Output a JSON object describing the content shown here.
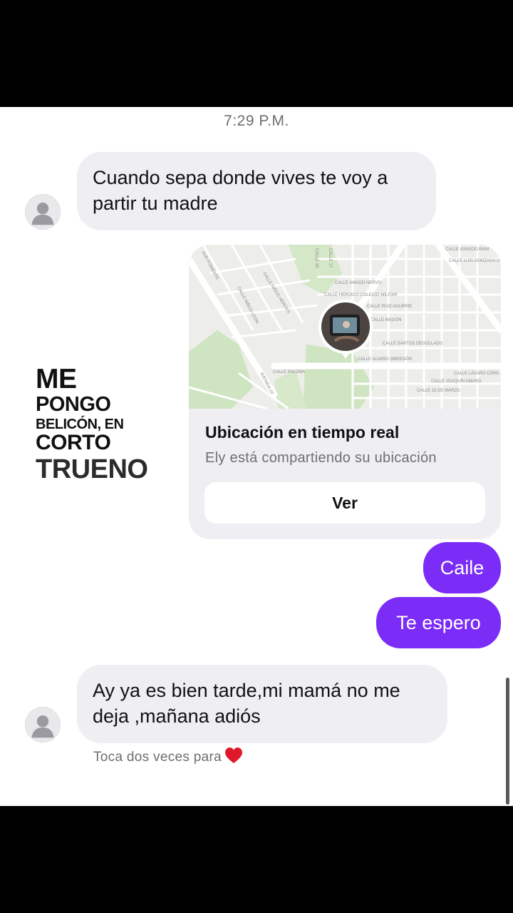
{
  "chat": {
    "timestamp": "7:29 P.M.",
    "messages": {
      "m1": {
        "line1": "Cuando sepa donde vives te voy a",
        "line2": "partir tu madre"
      },
      "m2": {
        "text": "Caile"
      },
      "m3": {
        "text": "Te espero"
      },
      "m4": {
        "line1": "Ay ya es bien tarde,mi mamá no me",
        "line2": "deja ,mañana adiós"
      }
    },
    "hint": "Toca dos veces para",
    "colors": {
      "outgoing": "#7b2cf6",
      "incoming": "#efeff3"
    }
  },
  "location_card": {
    "title": "Ubicación en tiempo real",
    "subtitle": "Ely está compartiendo su ubicación",
    "button": "Ver",
    "map_labels": {
      "l1": "CALLE IGNACIO RAM",
      "l2": "CALLE LUIS GONZAGA U",
      "l3": "CALLE AMADO NERVO",
      "l4": "CALLE HEROICO COLEGIO MILITAR",
      "l5": "CALLE RUIZ AGUIRRE",
      "l6": "CALLE MAGÓN",
      "l7": "CALLE SANTOS DEGOLLADO",
      "l8": "CALLE ALVARO OBREGÓN",
      "l9": "CALLE PALOMA",
      "l10": "AVENIDA 10",
      "l11": "CALLE LÁZARO CÁRD",
      "l12": "CALLE JOAQUÍN AMARO",
      "l13": "CALLE 18 DE MARZO",
      "l14": "SUR PONIENTE",
      "l15": "CALLE 16",
      "l16": "CALLE 17",
      "l17": "CALLE NIÑOS LEÓN",
      "l18": "CALLE NIÑOS HÉROES"
    }
  },
  "overlay": {
    "line1": "ME",
    "line2": "PONGO",
    "line3": "BELICÓN, EN",
    "line4": "CORTO",
    "line5": "TRUENO"
  }
}
